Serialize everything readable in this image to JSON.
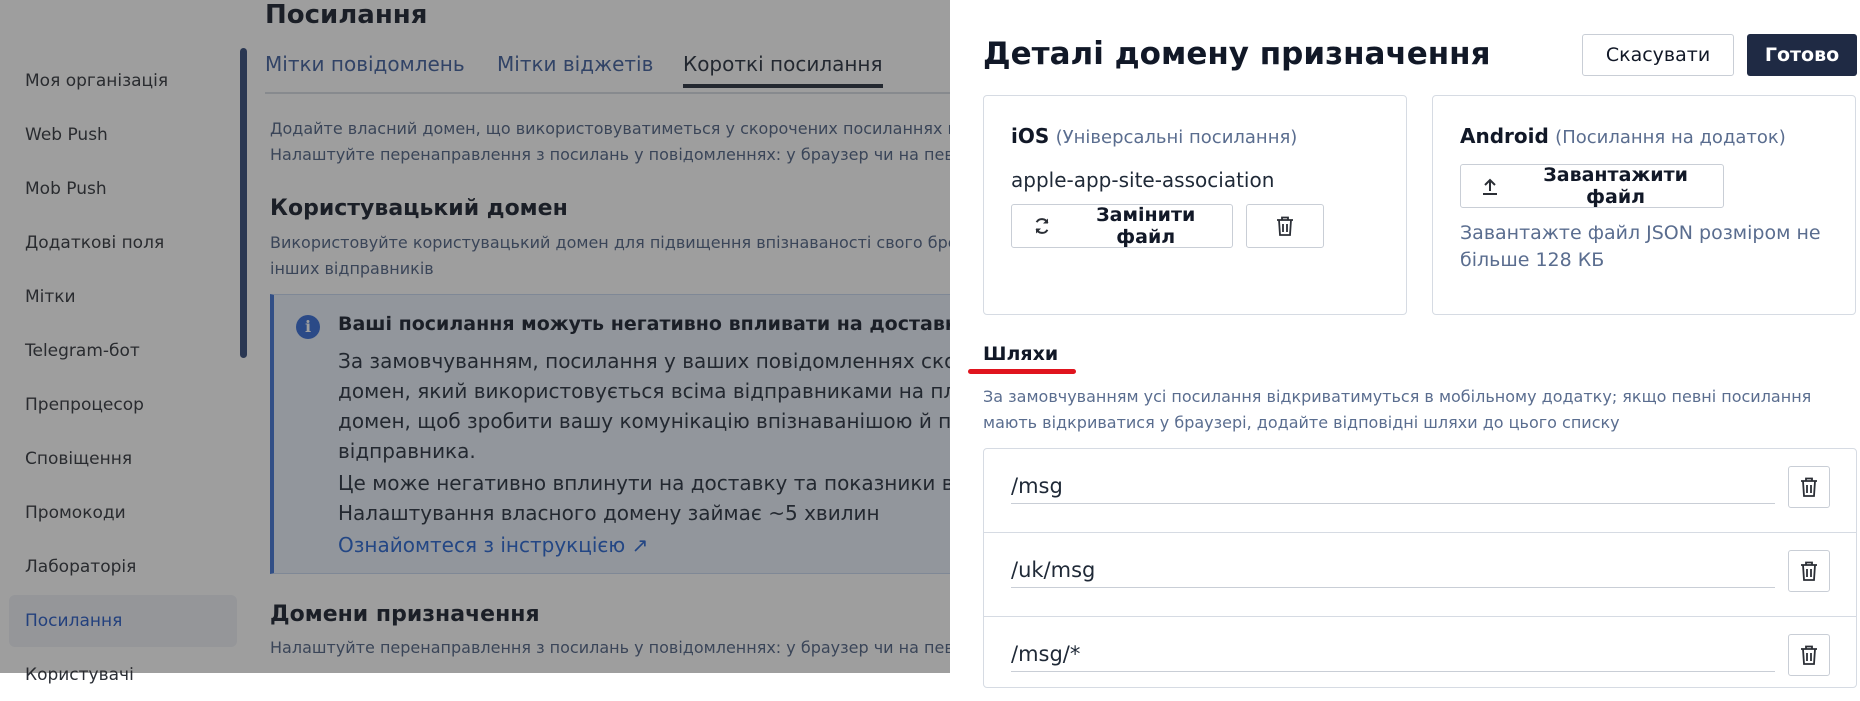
{
  "sidebar": {
    "items": [
      {
        "label": "Моя організація"
      },
      {
        "label": "Web Push"
      },
      {
        "label": "Mob Push"
      },
      {
        "label": "Додаткові поля"
      },
      {
        "label": "Мітки"
      },
      {
        "label": "Telegram-бот"
      },
      {
        "label": "Препроцесор"
      },
      {
        "label": "Сповіщення"
      },
      {
        "label": "Промокоди"
      },
      {
        "label": "Лабораторія"
      },
      {
        "label": "Посилання"
      },
      {
        "label": "Користувачі"
      }
    ]
  },
  "page": {
    "title": "Посилання",
    "tabs": [
      {
        "label": "Мітки повідомлень"
      },
      {
        "label": "Мітки віджетів"
      },
      {
        "label": "Короткі посилання"
      }
    ],
    "intro_line1": "Додайте власний домен, що використовуватиметься у скорочених посиланнях в п",
    "intro_line2": "Налаштуйте перенаправлення з посилань у повідомленнях: у браузер чи на певну",
    "custom_domain": {
      "title": "Користувацький домен",
      "desc_line1": "Використовуйте користувацький домен для підвищення впізнаваності свого брен",
      "desc_line2": "інших відправників"
    },
    "alert": {
      "title": "Ваші посилання можуть негативно впливати на доставку",
      "line1": "За замовчуванням, посилання у ваших повідомленнях скоро",
      "line2": "домен, який використовується всіма відправниками на плат",
      "line3": "домен, щоб зробити вашу комунікацію впізнаванішою й покр",
      "line4": "відправника.",
      "line5": "Це може негативно вплинути на доставку та показники відкр",
      "line6": "Налаштування власного домену займає ~5 хвилин",
      "link": "Ознайомтеся з інструкцією ↗"
    },
    "destination_domains": {
      "title": "Домени призначення",
      "desc": "Налаштуйте перенаправлення з посилань у повідомленнях: у браузер чи на певну"
    }
  },
  "drawer": {
    "title": "Деталі домену призначення",
    "cancel_label": "Скасувати",
    "done_label": "Готово",
    "ios": {
      "platform": "iOS",
      "subtitle": "(Універсальні посилання)",
      "file_name": "apple-app-site-association",
      "replace_label": "Замінити файл"
    },
    "android": {
      "platform": "Android",
      "subtitle": "(Посилання на додаток)",
      "upload_label": "Завантажити файл",
      "hint": "Завантажте файл JSON розміром не більше 128 КБ"
    },
    "paths": {
      "title": "Шляхи",
      "desc": "За замовчуванням усі посилання відкриватимуться в мобільному додатку; якщо певні посилання мають відкриватися у браузері, додайте відповідні шляхи до цього списку",
      "items": [
        {
          "value": "/msg"
        },
        {
          "value": "/uk/msg"
        },
        {
          "value": "/msg/*"
        }
      ]
    }
  }
}
